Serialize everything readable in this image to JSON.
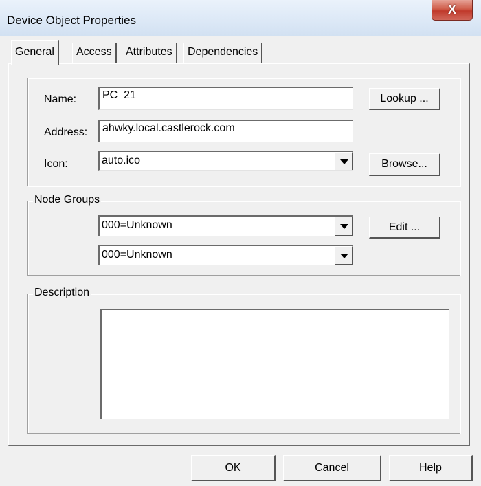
{
  "window": {
    "title": "Device Object Properties",
    "close_glyph": "X"
  },
  "tabs": [
    {
      "label": "General",
      "active": true
    },
    {
      "label": "Access",
      "active": false
    },
    {
      "label": "Attributes",
      "active": false
    },
    {
      "label": "Dependencies",
      "active": false
    }
  ],
  "general": {
    "name_label": "Name:",
    "name_value": "PC_21",
    "address_label": "Address:",
    "address_value": "ahwky.local.castlerock.com",
    "icon_label": "Icon:",
    "icon_value": "auto.ico",
    "lookup_button": "Lookup ...",
    "browse_button": "Browse..."
  },
  "node_groups": {
    "legend": "Node Groups",
    "group1_value": "000=Unknown",
    "group2_value": "000=Unknown",
    "edit_button": "Edit ..."
  },
  "description": {
    "legend": "Description",
    "value": ""
  },
  "footer": {
    "ok": "OK",
    "cancel": "Cancel",
    "help": "Help"
  },
  "icons": {
    "close": "close-icon",
    "dropdown": "chevron-down-icon"
  }
}
